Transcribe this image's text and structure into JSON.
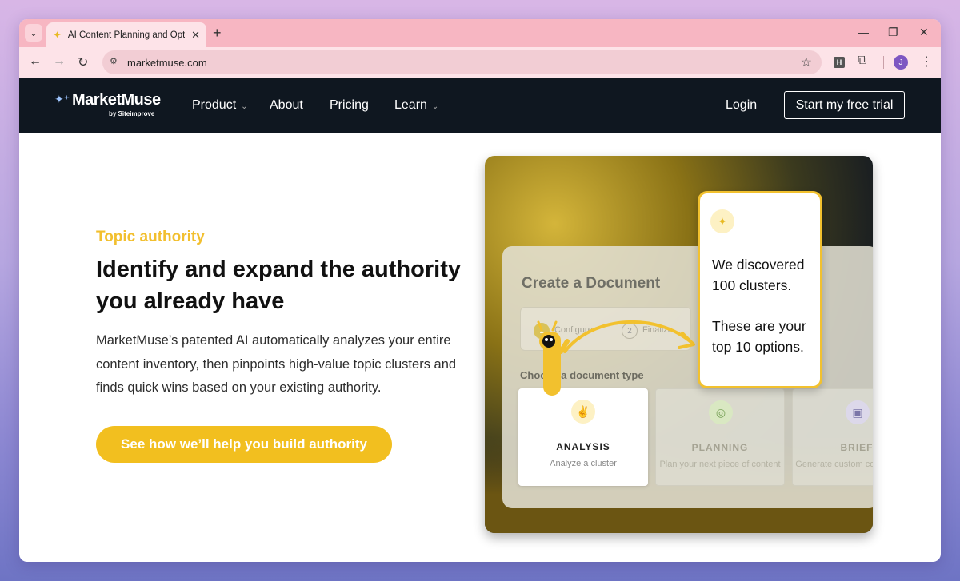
{
  "browser": {
    "tab_title": "AI Content Planning and Optim",
    "tab_icon": "sparkle-icon",
    "url": "marketmuse.com",
    "profile_initial": "J",
    "extension_label": "H"
  },
  "header": {
    "logo_name": "MarketMuse",
    "logo_sub": "by Siteimprove",
    "nav": [
      {
        "label": "Product",
        "has_caret": true
      },
      {
        "label": "About",
        "has_caret": false
      },
      {
        "label": "Pricing",
        "has_caret": false
      },
      {
        "label": "Learn",
        "has_caret": true
      }
    ],
    "login": "Login",
    "trial": "Start my free trial"
  },
  "hero": {
    "eyebrow": "Topic authority",
    "headline": "Identify and expand the authority you already have",
    "body": "MarketMuse’s patented AI automatically analyzes your entire content inventory, then pinpoints high-value topic clusters and finds quick wins based on your existing authority.",
    "cta": "See how we’ll help you build authority"
  },
  "illustration": {
    "doc_title": "Create a Document",
    "steps": [
      {
        "num": "1",
        "label": "Configure"
      },
      {
        "num": "2",
        "label": "Finalize"
      }
    ],
    "choose_label": "Choose a document type",
    "types": [
      {
        "name": "ANALYSIS",
        "desc": "Analyze a cluster",
        "active": true,
        "icon": "rabbit-icon"
      },
      {
        "name": "PLANNING",
        "desc": "Plan your next piece of content",
        "active": false,
        "icon": "compass-icon"
      },
      {
        "name": "BRIEF",
        "desc": "Generate custom content briefs",
        "active": false,
        "icon": "document-icon"
      }
    ],
    "bubble_line1": "We discovered 100 clusters.",
    "bubble_line2": "These are your top 10 options.",
    "accent": "#f2bf1f"
  }
}
